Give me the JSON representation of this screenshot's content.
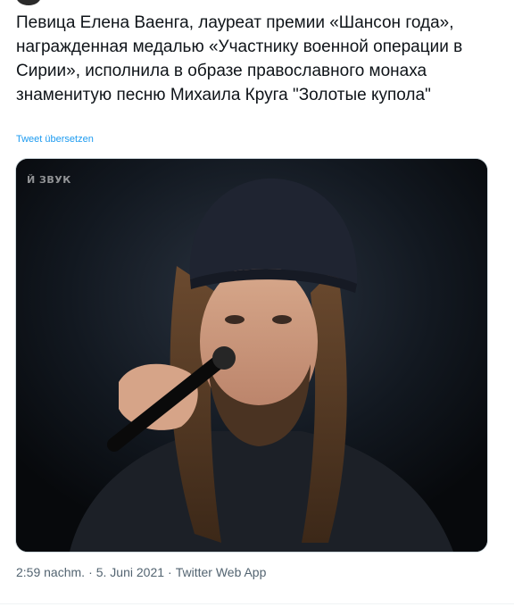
{
  "tweet": {
    "text": "Певица Елена Ваенга, лауреат премии «Шансон года», награжденная медалью «Участнику военной операции в Сирии», исполнила в образе православного монаха знаменитую песню Михаила Круга \"Золотые купола\"",
    "translate_label": "Tweet übersetzen"
  },
  "media": {
    "overlay_text": "Й ЗВУК",
    "image_description_icon": "photo"
  },
  "meta": {
    "time": "2:59 nachm.",
    "separator_1": "·",
    "date": "5. Juni 2021",
    "separator_2": "·",
    "source": "Twitter Web App"
  },
  "colors": {
    "text": "#0f1419",
    "link": "#1d9bf0",
    "meta": "#536471",
    "border": "#cfd9de"
  }
}
